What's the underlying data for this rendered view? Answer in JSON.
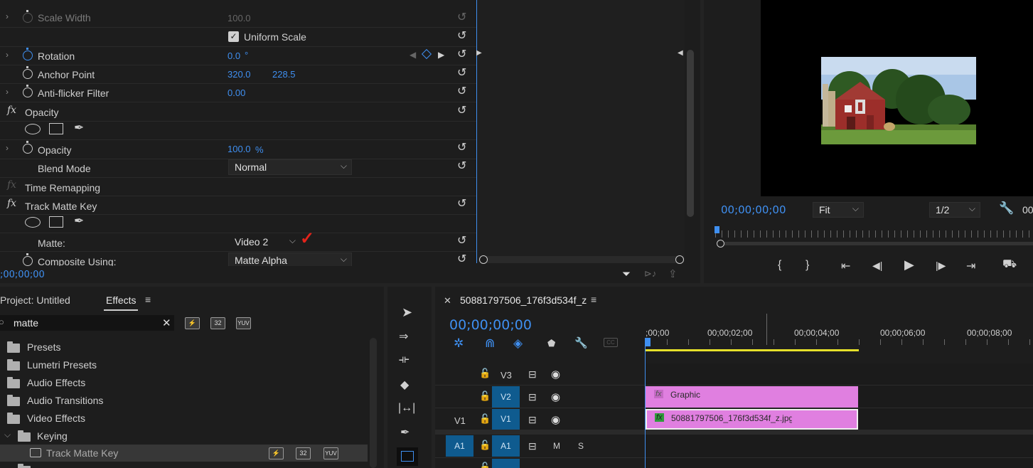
{
  "effect_controls": {
    "rows": {
      "scale_width": {
        "label": "Scale Width",
        "value": "100.0"
      },
      "uniform_scale": {
        "label": "Uniform Scale"
      },
      "rotation": {
        "label": "Rotation",
        "value": "0.0",
        "unit": "°"
      },
      "anchor_point": {
        "label": "Anchor Point",
        "x": "320.0",
        "y": "228.5"
      },
      "anti_flicker": {
        "label": "Anti-flicker Filter",
        "value": "0.00"
      },
      "opacity_group": {
        "label": "Opacity"
      },
      "opacity": {
        "label": "Opacity",
        "value": "100.0",
        "unit": "%"
      },
      "blend_mode": {
        "label": "Blend Mode",
        "value": "Normal"
      },
      "time_remapping": {
        "label": "Time Remapping"
      },
      "track_matte_key": {
        "label": "Track Matte Key"
      },
      "matte": {
        "label": "Matte:",
        "value": "Video 2"
      },
      "composite_using": {
        "label": "Composite Using:",
        "value": "Matte Alpha"
      }
    },
    "timecode": ";00;00;00"
  },
  "program_monitor": {
    "timecode": "00;00;00;00",
    "fit": "Fit",
    "resolution": "1/2",
    "right_tc_partial": "00"
  },
  "project_panel": {
    "tab_project": "Project: Untitled",
    "tab_effects": "Effects",
    "menu_icon": "hamburger-icon",
    "search_value": "matte",
    "badges": [
      "32",
      "YUV"
    ],
    "tree": [
      {
        "label": "Presets"
      },
      {
        "label": "Lumetri Presets"
      },
      {
        "label": "Audio Effects"
      },
      {
        "label": "Audio Transitions"
      },
      {
        "label": "Video Effects"
      },
      {
        "label": "Keying"
      },
      {
        "label": "Track Matte Key"
      }
    ]
  },
  "timeline": {
    "sequence_name": "50881797506_176f3d534f_z",
    "timecode": "00;00;00;00",
    "ruler": [
      ";00;00",
      "00;00;02;00",
      "00;00;04;00",
      "00;00;06;00",
      "00;00;08;00"
    ],
    "tracks": {
      "v3": "V3",
      "v2": "V2",
      "v1": "V1",
      "v1_src": "V1",
      "a1": "A1",
      "a1_src": "A1",
      "m": "M",
      "s": "S"
    },
    "clips": {
      "graphic": "Graphic",
      "image": "50881797506_176f3d534f_z.jpg"
    },
    "colors": {
      "clip": "#e07fe0",
      "accent": "#3f8ff0",
      "work_area": "#e5e02a"
    }
  }
}
